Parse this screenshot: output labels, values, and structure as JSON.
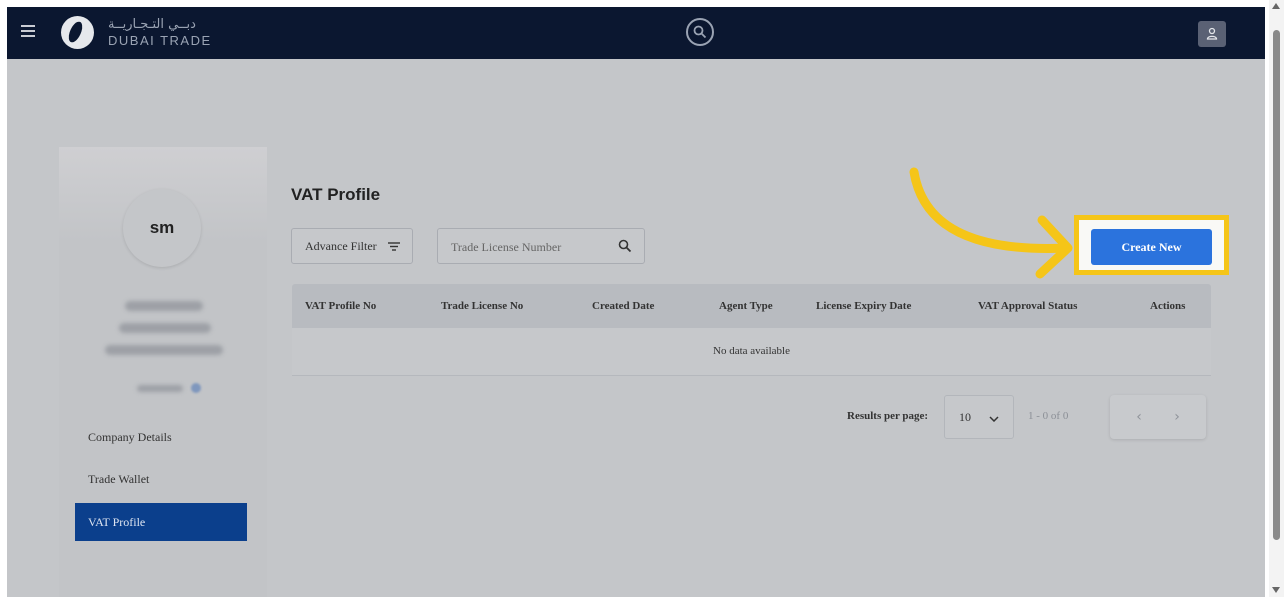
{
  "header": {
    "logo_arabic": "دبــي التـجـاريــة",
    "logo_english": "DUBAI TRADE"
  },
  "sidebar": {
    "avatar_initials": "sm",
    "items": [
      {
        "label": "Company Details"
      },
      {
        "label": "Trade Wallet"
      },
      {
        "label": "VAT Profile"
      }
    ]
  },
  "main": {
    "title": "VAT Profile",
    "advance_filter_label": "Advance Filter",
    "search_placeholder": "Trade License Number",
    "create_button_label": "Create New",
    "table": {
      "columns": [
        "VAT Profile No",
        "Trade License No",
        "Created Date",
        "Agent Type",
        "License Expiry Date",
        "VAT Approval Status",
        "Actions"
      ],
      "empty_text": "No data available"
    },
    "pagination": {
      "results_per_page_label": "Results per page:",
      "results_per_page_value": "10",
      "range_text": "1 - 0 of 0"
    }
  },
  "colors": {
    "topbar": "#0b1730",
    "active_nav": "#0b3f8c",
    "primary_button": "#2b73dd",
    "highlight": "#f5c518"
  },
  "icons": [
    "menu-icon",
    "dubai-trade-logo",
    "search-icon",
    "user-icon",
    "filter-icon",
    "chevron-down-icon",
    "chevron-left-icon",
    "chevron-right-icon",
    "curved-arrow-icon"
  ]
}
